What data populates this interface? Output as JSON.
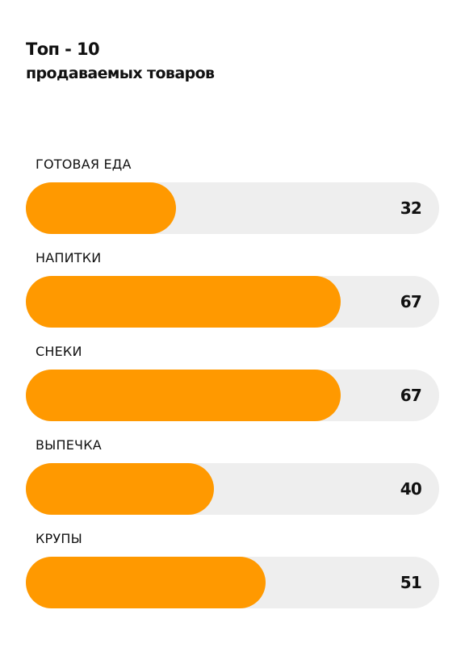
{
  "title": {
    "line1": "Топ - 10",
    "line2": "продаваемых товаров"
  },
  "colors": {
    "bar_fill": "#ff9900",
    "bar_track": "#eeeeee",
    "text": "#111111"
  },
  "chart_data": {
    "type": "bar",
    "orientation": "horizontal",
    "title": "Топ - 10 продаваемых товаров",
    "categories": [
      "ГОТОВАЯ ЕДА",
      "НАПИТКИ",
      "СНЕКИ",
      "ВЫПЕЧКА",
      "КРУПЫ"
    ],
    "values": [
      32,
      67,
      67,
      40,
      51
    ],
    "xlim": [
      0,
      88
    ],
    "grid": false,
    "legend": "none"
  }
}
